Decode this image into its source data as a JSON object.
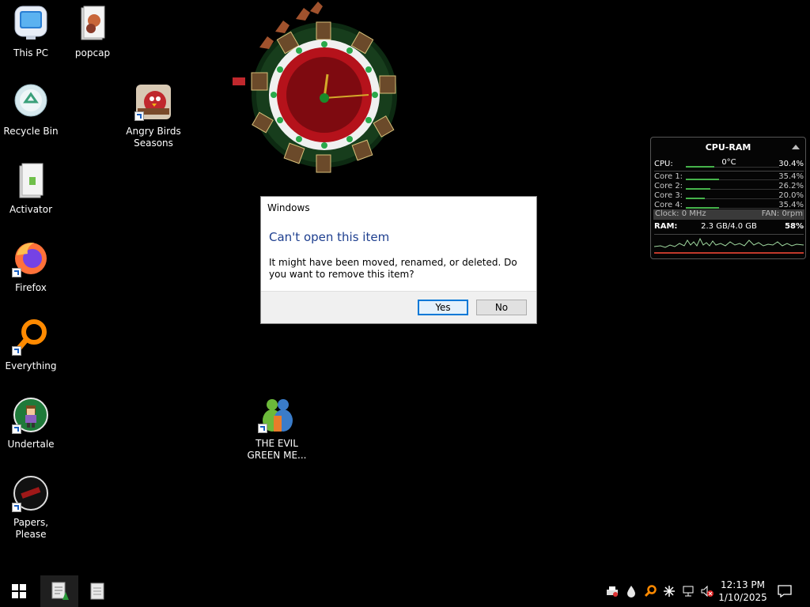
{
  "desktop": {
    "icons": [
      {
        "name": "This PC",
        "icon": "this-pc-icon"
      },
      {
        "name": "popcap",
        "icon": "folder-icon"
      },
      {
        "name": "Recycle Bin",
        "icon": "recycle-bin-icon"
      },
      {
        "name": "Angry Birds\nSeasons",
        "icon": "angry-birds-icon"
      },
      {
        "name": "Activator",
        "icon": "folder-icon"
      },
      {
        "name": "Firefox",
        "icon": "firefox-icon"
      },
      {
        "name": "Everything",
        "icon": "everything-search-icon"
      },
      {
        "name": "Undertale",
        "icon": "undertale-icon"
      },
      {
        "name": "Papers, Please",
        "icon": "papers-please-icon"
      },
      {
        "name": "THE EVIL\nGREEN ME...",
        "icon": "messenger-icon"
      }
    ]
  },
  "dialog": {
    "window_title": "Windows",
    "heading": "Can't open this item",
    "message": "It might have been moved, renamed, or deleted. Do you want to remove this item?",
    "yes_label": "Yes",
    "no_label": "No"
  },
  "gadget": {
    "title": "CPU-RAM",
    "cpu_label": "CPU:",
    "cpu_temp": "0°C",
    "cpu_value": "30.4%",
    "cores": [
      {
        "label": "Core 1:",
        "value": "35.4%",
        "level": 0.354
      },
      {
        "label": "Core 2:",
        "value": "26.2%",
        "level": 0.262
      },
      {
        "label": "Core 3:",
        "value": "20.0%",
        "level": 0.2
      },
      {
        "label": "Core 4:",
        "value": "35.4%",
        "level": 0.354
      }
    ],
    "cpu_level": 0.304,
    "clock_text": "Clock: 0 MHz",
    "fan_text": "FAN: 0rpm",
    "ram_label": "RAM:",
    "ram_usage": "2.3 GB/4.0 GB",
    "ram_value": "58%",
    "colors": {
      "bar": "#46b34b",
      "graph": "#9fd89f",
      "ram_line": "#c0392b"
    }
  },
  "taskbar": {
    "time": "12:13 PM",
    "date": "1/10/2025",
    "tray_icons": [
      "printer-icon",
      "water-drop-icon",
      "everything-search-icon",
      "snowflake-icon",
      "network-icon",
      "volume-muted-icon"
    ],
    "app_icons": [
      "notepad-icon",
      "document-icon"
    ]
  },
  "clock_widget": {
    "icon": "christmas-clock-icon"
  }
}
